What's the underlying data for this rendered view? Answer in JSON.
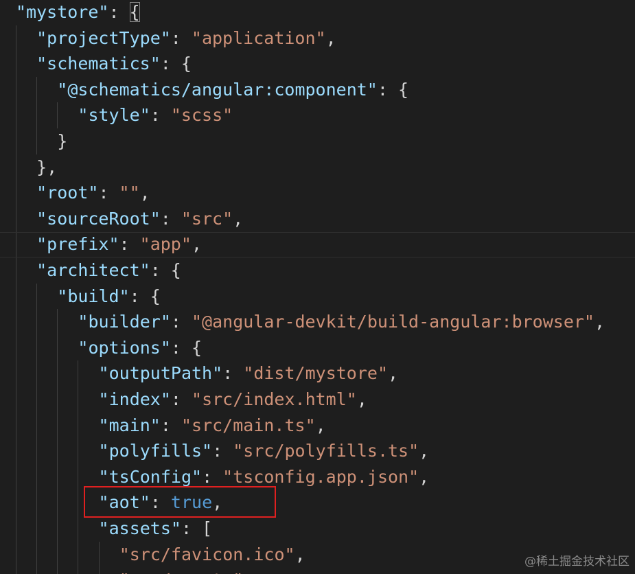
{
  "editor": {
    "lines": [
      {
        "tokens": [
          {
            "t": "\"mystore\"",
            "c": "k"
          },
          {
            "t": ": ",
            "c": "p"
          },
          {
            "t": "{",
            "c": "p",
            "box": true
          }
        ]
      },
      {
        "tokens": [
          {
            "t": "\"projectType\"",
            "c": "k"
          },
          {
            "t": ": ",
            "c": "p"
          },
          {
            "t": "\"application\"",
            "c": "s"
          },
          {
            "t": ",",
            "c": "p"
          }
        ]
      },
      {
        "tokens": [
          {
            "t": "\"schematics\"",
            "c": "k"
          },
          {
            "t": ": {",
            "c": "p"
          }
        ]
      },
      {
        "tokens": [
          {
            "t": "\"@schematics/angular:component\"",
            "c": "k"
          },
          {
            "t": ": {",
            "c": "p"
          }
        ]
      },
      {
        "tokens": [
          {
            "t": "\"style\"",
            "c": "k"
          },
          {
            "t": ": ",
            "c": "p"
          },
          {
            "t": "\"scss\"",
            "c": "s"
          }
        ]
      },
      {
        "tokens": [
          {
            "t": "}",
            "c": "p"
          }
        ]
      },
      {
        "tokens": [
          {
            "t": "},",
            "c": "p"
          }
        ]
      },
      {
        "tokens": [
          {
            "t": "\"root\"",
            "c": "k"
          },
          {
            "t": ": ",
            "c": "p"
          },
          {
            "t": "\"\"",
            "c": "s"
          },
          {
            "t": ",",
            "c": "p"
          }
        ]
      },
      {
        "tokens": [
          {
            "t": "\"sourceRoot\"",
            "c": "k"
          },
          {
            "t": ": ",
            "c": "p"
          },
          {
            "t": "\"src\"",
            "c": "s"
          },
          {
            "t": ",",
            "c": "p"
          }
        ]
      },
      {
        "tokens": [
          {
            "t": "\"prefix\"",
            "c": "k"
          },
          {
            "t": ": ",
            "c": "p"
          },
          {
            "t": "\"app\"",
            "c": "s"
          },
          {
            "t": ",",
            "c": "p"
          }
        ]
      },
      {
        "tokens": [
          {
            "t": "\"architect\"",
            "c": "k"
          },
          {
            "t": ": {",
            "c": "p"
          }
        ]
      },
      {
        "tokens": [
          {
            "t": "\"build\"",
            "c": "k"
          },
          {
            "t": ": {",
            "c": "p"
          }
        ]
      },
      {
        "tokens": [
          {
            "t": "\"builder\"",
            "c": "k"
          },
          {
            "t": ": ",
            "c": "p"
          },
          {
            "t": "\"@angular-devkit/build-angular:browser\"",
            "c": "s"
          },
          {
            "t": ",",
            "c": "p"
          }
        ]
      },
      {
        "tokens": [
          {
            "t": "\"options\"",
            "c": "k"
          },
          {
            "t": ": {",
            "c": "p"
          }
        ]
      },
      {
        "tokens": [
          {
            "t": "\"outputPath\"",
            "c": "k"
          },
          {
            "t": ": ",
            "c": "p"
          },
          {
            "t": "\"dist/mystore\"",
            "c": "s"
          },
          {
            "t": ",",
            "c": "p"
          }
        ]
      },
      {
        "tokens": [
          {
            "t": "\"index\"",
            "c": "k"
          },
          {
            "t": ": ",
            "c": "p"
          },
          {
            "t": "\"src/index.html\"",
            "c": "s"
          },
          {
            "t": ",",
            "c": "p"
          }
        ]
      },
      {
        "tokens": [
          {
            "t": "\"main\"",
            "c": "k"
          },
          {
            "t": ": ",
            "c": "p"
          },
          {
            "t": "\"src/main.ts\"",
            "c": "s"
          },
          {
            "t": ",",
            "c": "p"
          }
        ]
      },
      {
        "tokens": [
          {
            "t": "\"polyfills\"",
            "c": "k"
          },
          {
            "t": ": ",
            "c": "p"
          },
          {
            "t": "\"src/polyfills.ts\"",
            "c": "s"
          },
          {
            "t": ",",
            "c": "p"
          }
        ]
      },
      {
        "tokens": [
          {
            "t": "\"tsConfig\"",
            "c": "k"
          },
          {
            "t": ": ",
            "c": "p"
          },
          {
            "t": "\"tsconfig.app.json\"",
            "c": "s"
          },
          {
            "t": ",",
            "c": "p"
          }
        ]
      },
      {
        "tokens": [
          {
            "t": "\"aot\"",
            "c": "k"
          },
          {
            "t": ": ",
            "c": "p"
          },
          {
            "t": "true",
            "c": "b"
          },
          {
            "t": ",",
            "c": "p"
          }
        ]
      },
      {
        "tokens": [
          {
            "t": "\"assets\"",
            "c": "k"
          },
          {
            "t": ": [",
            "c": "p"
          }
        ]
      },
      {
        "tokens": [
          {
            "t": "\"src/favicon.ico\"",
            "c": "s"
          },
          {
            "t": ",",
            "c": "p"
          }
        ]
      },
      {
        "tokens": [
          {
            "t": "\"src/assets\"",
            "c": "s"
          }
        ]
      }
    ]
  },
  "watermark": "@稀土掘金技术社区",
  "colors": {
    "background": "#1e1e1e",
    "property_key": "#9cdcfe",
    "string_value": "#ce9178",
    "boolean_value": "#569cd6",
    "punctuation": "#d4d4d4",
    "highlight_box": "#e02020"
  }
}
